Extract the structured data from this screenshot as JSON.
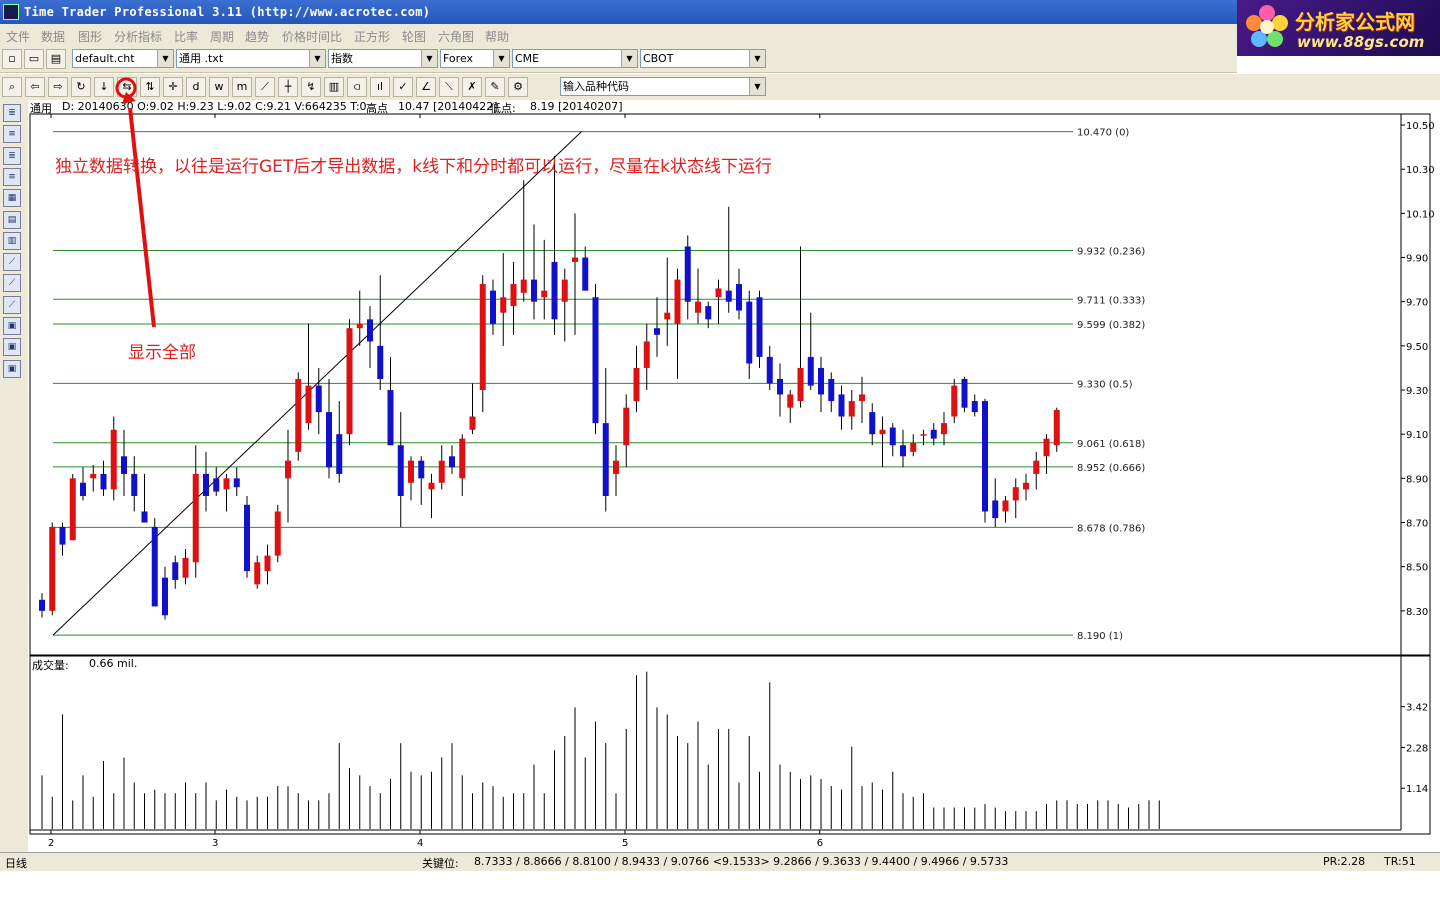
{
  "window": {
    "title": "Time Trader Professional 3.11 (http://www.acrotec.com)"
  },
  "logo": {
    "brand": "分析家公式网",
    "url": "www.88gs.com"
  },
  "menu": [
    "文件",
    "数据",
    "图形",
    "分析指标",
    "比率",
    "周期",
    "趋势",
    "价格时间比",
    "正方形",
    "轮图",
    "六角图",
    "帮助"
  ],
  "toolbar": {
    "chart_file": "default.cht",
    "data_file": "通用 .txt",
    "category": "指数",
    "market1": "Forex",
    "market2": "CME",
    "market3": "CBOT",
    "symbol_placeholder": "输入品种代码",
    "icons": [
      "zoom-icon",
      "arrow-left-icon",
      "arrow-right-icon",
      "arrow-up-icon",
      "arrow-down-icon",
      "show-all-icon",
      "sort-icon",
      "crosshair-icon",
      "daily-d-icon",
      "weekly-w-icon",
      "monthly-m-icon",
      "line-tool-icon",
      "fib-tool-icon",
      "fan-tool-icon",
      "gann-tool-icon",
      "bar-chart-icon",
      "candle-icon",
      "check-line-icon",
      "angle-icon",
      "slope-icon",
      "eraser-icon",
      "brush-icon",
      "settings-icon"
    ],
    "icon_glyphs": [
      "⌕",
      "⇦",
      "⇨",
      "↻",
      "↓",
      "⇆",
      "⇅",
      "✛",
      "d",
      "w",
      "m",
      "⟋",
      "┼",
      "↯",
      "▥",
      "⫏",
      "ıl",
      "✓",
      "∠",
      "⟍",
      "✗",
      "✎",
      "⚙"
    ]
  },
  "leftbar_glyphs": [
    "≣",
    "≡",
    "≣",
    "≡",
    "▦",
    "▤",
    "▥",
    "⟋",
    "⟋",
    "⟋",
    "▣",
    "▣",
    "▣"
  ],
  "info": {
    "label": "通用",
    "ohlc": "D: 20140630  O:9.02  H:9.23  L:9.02  C:9.21  V:664235  T:0",
    "high_label": "高点",
    "high_value": "10.47 [20140422]",
    "low_label": "低点:",
    "low_value": "8.19 [20140207]"
  },
  "annotations": {
    "main_note": "独立数据转换，以往是运行GET后才导出数据，k线下和分时都可以运行，尽量在k状态线下运行",
    "show_all": "显示全部"
  },
  "volume_panel": {
    "label": "成交量:",
    "value": "0.66 mil."
  },
  "status": {
    "period": "日线",
    "key_label": "关键位:",
    "key_values": "8.7333 / 8.8666 / 8.8100 / 8.9433 / 9.0766 <9.1533> 9.2866 / 9.3633 / 9.4400 / 9.4966 / 9.5733",
    "pr": "PR:2.28",
    "tr": "TR:51"
  },
  "colors": {
    "up": "#dd1111",
    "down": "#1111cc",
    "fib": "#2e8b2e",
    "annot": "#e02020"
  },
  "chart_data": {
    "type": "candlestick",
    "ylim": [
      8.1,
      10.55
    ],
    "yticks": [
      "10.50",
      "10.30",
      "10.10",
      "9.90",
      "9.70",
      "9.50",
      "9.30",
      "9.10",
      "8.90",
      "8.70",
      "8.50",
      "8.30"
    ],
    "ytick_values": [
      10.5,
      10.3,
      10.1,
      9.9,
      9.7,
      9.5,
      9.3,
      9.1,
      8.9,
      8.7,
      8.5,
      8.3
    ],
    "xticks": [
      {
        "label": "2",
        "i": 0
      },
      {
        "label": "3",
        "i": 16
      },
      {
        "label": "4",
        "i": 36
      },
      {
        "label": "5",
        "i": 56
      },
      {
        "label": "6",
        "i": 75
      }
    ],
    "fib_levels": [
      {
        "value": 10.47,
        "label": "10.470  (0)"
      },
      {
        "value": 9.932,
        "label": "9.932  (0.236)"
      },
      {
        "value": 9.711,
        "label": "9.711  (0.333)"
      },
      {
        "value": 9.599,
        "label": "9.599  (0.382)"
      },
      {
        "value": 9.33,
        "label": "9.330  (0.5)"
      },
      {
        "value": 9.061,
        "label": "9.061  (0.618)"
      },
      {
        "value": 8.952,
        "label": "8.952  (0.666)"
      },
      {
        "value": 8.678,
        "label": "8.678  (0.786)"
      },
      {
        "value": 8.19,
        "label": "8.190  (1)"
      }
    ],
    "trendline": {
      "from": {
        "i": 0,
        "value": 8.19
      },
      "to": {
        "i": 50,
        "value": 10.47
      }
    },
    "ohlc": [
      [
        8.35,
        8.38,
        8.27,
        8.3
      ],
      [
        8.3,
        8.7,
        8.28,
        8.68
      ],
      [
        8.68,
        8.7,
        8.55,
        8.6
      ],
      [
        8.62,
        8.92,
        8.62,
        8.9
      ],
      [
        8.88,
        8.95,
        8.8,
        8.82
      ],
      [
        8.9,
        8.96,
        8.84,
        8.92
      ],
      [
        8.92,
        8.98,
        8.82,
        8.85
      ],
      [
        8.85,
        9.18,
        8.8,
        9.12
      ],
      [
        9.0,
        9.12,
        8.82,
        8.92
      ],
      [
        8.92,
        9.0,
        8.75,
        8.82
      ],
      [
        8.75,
        8.92,
        8.72,
        8.7
      ],
      [
        8.68,
        8.72,
        8.4,
        8.32
      ],
      [
        8.45,
        8.5,
        8.26,
        8.28
      ],
      [
        8.52,
        8.55,
        8.4,
        8.44
      ],
      [
        8.45,
        8.58,
        8.42,
        8.54
      ],
      [
        8.52,
        9.05,
        8.45,
        8.92
      ],
      [
        8.92,
        9.02,
        8.75,
        8.82
      ],
      [
        8.9,
        8.95,
        8.82,
        8.84
      ],
      [
        8.85,
        8.92,
        8.75,
        8.9
      ],
      [
        8.9,
        8.95,
        8.82,
        8.86
      ],
      [
        8.78,
        8.82,
        8.45,
        8.48
      ],
      [
        8.42,
        8.55,
        8.4,
        8.52
      ],
      [
        8.48,
        8.6,
        8.42,
        8.55
      ],
      [
        8.55,
        8.78,
        8.52,
        8.75
      ],
      [
        8.9,
        9.12,
        8.7,
        8.98
      ],
      [
        9.02,
        9.38,
        8.98,
        9.35
      ],
      [
        9.15,
        9.6,
        9.12,
        9.32
      ],
      [
        9.32,
        9.4,
        9.1,
        9.2
      ],
      [
        9.2,
        9.35,
        8.9,
        8.95
      ],
      [
        9.1,
        9.25,
        8.88,
        8.92
      ],
      [
        9.1,
        9.62,
        9.05,
        9.58
      ],
      [
        9.58,
        9.75,
        9.5,
        9.6
      ],
      [
        9.62,
        9.68,
        9.4,
        9.52
      ],
      [
        9.5,
        9.82,
        9.3,
        9.35
      ],
      [
        9.3,
        9.45,
        9.05,
        9.05
      ],
      [
        9.05,
        9.2,
        8.68,
        8.82
      ],
      [
        8.88,
        9.0,
        8.8,
        8.98
      ],
      [
        8.98,
        9.0,
        8.78,
        8.9
      ],
      [
        8.85,
        8.92,
        8.72,
        8.88
      ],
      [
        8.88,
        9.05,
        8.85,
        8.98
      ],
      [
        9.0,
        9.05,
        8.92,
        8.95
      ],
      [
        8.9,
        9.1,
        8.82,
        9.08
      ],
      [
        9.12,
        9.33,
        9.1,
        9.18
      ],
      [
        9.3,
        9.82,
        9.2,
        9.78
      ],
      [
        9.75,
        9.8,
        9.55,
        9.6
      ],
      [
        9.65,
        9.92,
        9.5,
        9.72
      ],
      [
        9.68,
        9.88,
        9.55,
        9.78
      ],
      [
        9.74,
        10.25,
        9.7,
        9.8
      ],
      [
        9.8,
        10.05,
        9.62,
        9.7
      ],
      [
        9.72,
        9.98,
        9.62,
        9.75
      ],
      [
        9.88,
        10.36,
        9.55,
        9.62
      ],
      [
        9.7,
        9.85,
        9.52,
        9.8
      ],
      [
        9.88,
        10.1,
        9.55,
        9.9
      ],
      [
        9.9,
        9.95,
        9.75,
        9.75
      ],
      [
        9.72,
        9.78,
        9.1,
        9.15
      ],
      [
        9.15,
        9.4,
        8.75,
        8.82
      ],
      [
        8.92,
        9.05,
        8.82,
        8.98
      ],
      [
        9.05,
        9.28,
        8.95,
        9.22
      ],
      [
        9.25,
        9.5,
        9.2,
        9.4
      ],
      [
        9.4,
        9.6,
        9.3,
        9.52
      ],
      [
        9.58,
        9.72,
        9.45,
        9.55
      ],
      [
        9.62,
        9.9,
        9.5,
        9.65
      ],
      [
        9.6,
        9.85,
        9.35,
        9.8
      ],
      [
        9.95,
        10.0,
        9.62,
        9.7
      ],
      [
        9.65,
        9.85,
        9.6,
        9.7
      ],
      [
        9.68,
        9.7,
        9.58,
        9.62
      ],
      [
        9.72,
        9.8,
        9.6,
        9.76
      ],
      [
        9.75,
        10.13,
        9.65,
        9.7
      ],
      [
        9.78,
        9.85,
        9.62,
        9.66
      ],
      [
        9.7,
        9.75,
        9.35,
        9.42
      ],
      [
        9.72,
        9.75,
        9.4,
        9.45
      ],
      [
        9.45,
        9.5,
        9.3,
        9.33
      ],
      [
        9.35,
        9.42,
        9.18,
        9.28
      ],
      [
        9.22,
        9.3,
        9.15,
        9.28
      ],
      [
        9.25,
        9.95,
        9.22,
        9.4
      ],
      [
        9.45,
        9.65,
        9.3,
        9.32
      ],
      [
        9.4,
        9.45,
        9.2,
        9.28
      ],
      [
        9.35,
        9.38,
        9.2,
        9.25
      ],
      [
        9.28,
        9.32,
        9.12,
        9.18
      ],
      [
        9.18,
        9.3,
        9.12,
        9.25
      ],
      [
        9.25,
        9.36,
        9.15,
        9.28
      ],
      [
        9.2,
        9.24,
        9.05,
        9.1
      ],
      [
        9.1,
        9.18,
        8.95,
        9.12
      ],
      [
        9.13,
        9.15,
        9.0,
        9.05
      ],
      [
        9.05,
        9.12,
        8.95,
        9.0
      ],
      [
        9.02,
        9.1,
        9.0,
        9.06
      ],
      [
        9.1,
        9.12,
        9.05,
        9.1
      ],
      [
        9.12,
        9.15,
        9.05,
        9.08
      ],
      [
        9.1,
        9.2,
        9.05,
        9.15
      ],
      [
        9.18,
        9.35,
        9.15,
        9.32
      ],
      [
        9.35,
        9.36,
        9.2,
        9.22
      ],
      [
        9.25,
        9.28,
        9.18,
        9.2
      ],
      [
        9.25,
        9.26,
        8.7,
        8.75
      ],
      [
        8.8,
        8.9,
        8.68,
        8.72
      ],
      [
        8.75,
        8.82,
        8.7,
        8.8
      ],
      [
        8.8,
        8.9,
        8.72,
        8.86
      ],
      [
        8.85,
        8.92,
        8.8,
        8.88
      ],
      [
        8.92,
        9.02,
        8.85,
        8.98
      ],
      [
        9.0,
        9.1,
        8.92,
        9.08
      ],
      [
        9.05,
        9.22,
        9.02,
        9.21
      ]
    ],
    "volume": {
      "yticks": [
        "3.42",
        "2.28",
        "1.14"
      ],
      "ytick_values": [
        3.42,
        2.28,
        1.14
      ],
      "values": [
        1.5,
        0.9,
        3.2,
        0.8,
        1.5,
        0.9,
        1.9,
        1.0,
        2.0,
        1.3,
        1.0,
        1.1,
        1.0,
        1.0,
        1.3,
        1.0,
        1.3,
        0.8,
        1.1,
        0.9,
        0.8,
        0.9,
        0.9,
        1.2,
        1.2,
        1.0,
        0.8,
        0.8,
        1.0,
        2.4,
        1.7,
        1.5,
        1.2,
        1.0,
        1.4,
        2.4,
        1.6,
        1.5,
        1.6,
        2.0,
        2.4,
        1.5,
        1.0,
        1.3,
        1.2,
        0.9,
        1.0,
        1.0,
        1.8,
        1.0,
        2.2,
        2.6,
        3.4,
        2.0,
        3.0,
        2.4,
        1.0,
        2.8,
        4.3,
        4.4,
        3.4,
        3.2,
        2.6,
        2.4,
        3.0,
        1.8,
        2.8,
        2.8,
        1.3,
        2.6,
        1.6,
        4.1,
        1.8,
        1.6,
        1.4,
        1.5,
        1.4,
        1.2,
        1.1,
        2.3,
        1.2,
        1.3,
        1.1,
        1.6,
        1.0,
        0.9,
        1.0,
        0.6,
        0.6,
        0.6,
        0.6,
        0.6,
        0.7,
        0.6,
        0.5,
        0.5,
        0.5,
        0.5,
        0.7,
        0.8,
        0.8,
        0.7,
        0.7,
        0.8,
        0.8,
        0.7,
        0.6,
        0.7,
        0.8,
        0.8
      ]
    }
  }
}
